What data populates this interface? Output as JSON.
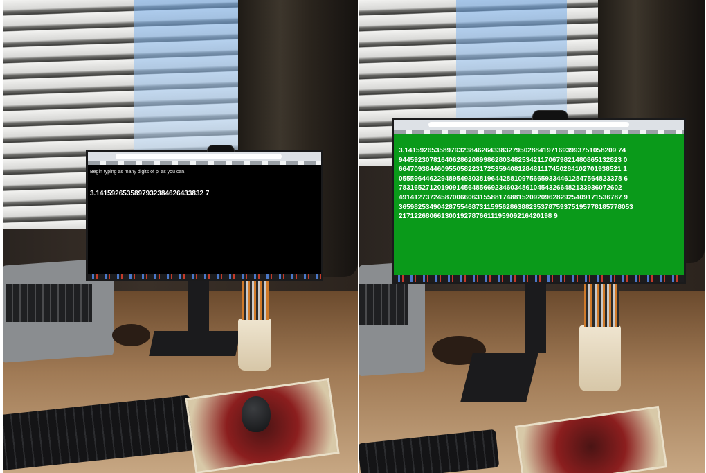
{
  "left_photo": {
    "screen": {
      "instruction": "Begin typing as many digits of pi as you can.",
      "typed_digits": "3.1415926535897932384626433832 7",
      "background_color": "#000000",
      "text_color": "#ffffff"
    }
  },
  "right_photo": {
    "screen": {
      "lines": [
        "3.1415926535897932384626433832795028841971693993751058209 74",
        "9445923078164062862089986280348253421170679821480865132823 0",
        "6647093844609550582231725359408128481117450284102701938521 1",
        "0555964462294895493038196442881097566593344612847564823378 6",
        "7831652712019091456485669234603486104543266482133936072602",
        "4914127372458700660631558817488152092096282925409171536787 9",
        "3659825349042875546873115956286388235378759375195778185778053",
        "2171226806613001927876611195909216420198 9"
      ],
      "background_color": "#0a9a1a",
      "text_color": "#ffffff"
    }
  }
}
